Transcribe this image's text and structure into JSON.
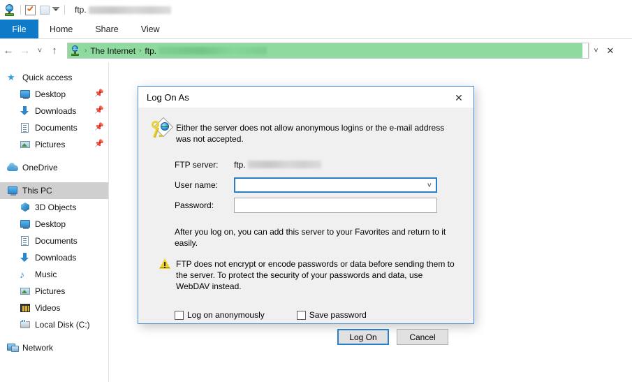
{
  "window": {
    "title_prefix": "ftp.",
    "title_redacted": true,
    "quick_access": [
      {
        "name": "ftp-site-icon",
        "label": "FTP site"
      },
      {
        "name": "properties-icon",
        "label": "Properties"
      },
      {
        "name": "new-folder-icon",
        "label": "New folder"
      },
      {
        "name": "customize-quick-access-caret",
        "label": "Customize Quick Access Toolbar"
      }
    ]
  },
  "ribbon": {
    "file_tab": "File",
    "tabs": [
      "Home",
      "Share",
      "View"
    ]
  },
  "navbar": {
    "back_icon": "←",
    "forward_icon": "→",
    "recent_icon": "˅",
    "up_icon": "↑",
    "breadcrumbs": [
      "The Internet",
      "ftp."
    ],
    "breadcrumb_separator": "›",
    "address_redacted": true,
    "progress_green": "#8fdb9f",
    "dropdown_icon": "˅",
    "stop_icon": "✕"
  },
  "sidebar": {
    "items": [
      {
        "label": "Quick access",
        "icon": "star-icon",
        "level": 0,
        "pinned": false,
        "selected": false
      },
      {
        "label": "Desktop",
        "icon": "desktop-icon",
        "level": 1,
        "pinned": true,
        "selected": false
      },
      {
        "label": "Downloads",
        "icon": "downloads-icon",
        "level": 1,
        "pinned": true,
        "selected": false
      },
      {
        "label": "Documents",
        "icon": "documents-icon",
        "level": 1,
        "pinned": true,
        "selected": false
      },
      {
        "label": "Pictures",
        "icon": "pictures-icon",
        "level": 1,
        "pinned": true,
        "selected": false
      },
      {
        "label": "OneDrive",
        "icon": "onedrive-cloud-icon",
        "level": 0,
        "pinned": false,
        "selected": false
      },
      {
        "label": "This PC",
        "icon": "this-pc-icon",
        "level": 0,
        "pinned": false,
        "selected": true
      },
      {
        "label": "3D Objects",
        "icon": "3d-objects-icon",
        "level": 1,
        "pinned": false,
        "selected": false
      },
      {
        "label": "Desktop",
        "icon": "desktop-icon",
        "level": 1,
        "pinned": false,
        "selected": false
      },
      {
        "label": "Documents",
        "icon": "documents-icon",
        "level": 1,
        "pinned": false,
        "selected": false
      },
      {
        "label": "Downloads",
        "icon": "downloads-icon",
        "level": 1,
        "pinned": false,
        "selected": false
      },
      {
        "label": "Music",
        "icon": "music-icon",
        "level": 1,
        "pinned": false,
        "selected": false
      },
      {
        "label": "Pictures",
        "icon": "pictures-icon",
        "level": 1,
        "pinned": false,
        "selected": false
      },
      {
        "label": "Videos",
        "icon": "videos-icon",
        "level": 1,
        "pinned": false,
        "selected": false
      },
      {
        "label": "Local Disk (C:)",
        "icon": "local-disk-icon",
        "level": 1,
        "pinned": false,
        "selected": false
      },
      {
        "label": "Network",
        "icon": "network-icon",
        "level": 0,
        "pinned": false,
        "selected": false
      }
    ],
    "pin_glyph": "📌"
  },
  "dialog": {
    "title": "Log On As",
    "close_icon": "✕",
    "message": "Either the server does not allow anonymous logins or the e-mail address was not accepted.",
    "fields": {
      "server_label": "FTP server:",
      "server_value_prefix": "ftp.",
      "server_value_redacted": true,
      "username_label": "User name:",
      "username_value": "",
      "username_dropdown_icon": "˅",
      "password_label": "Password:",
      "password_value": ""
    },
    "hint": "After you log on, you can add this server to your Favorites and return to it easily.",
    "warning": "FTP does not encrypt or encode passwords or data before sending them to the server.  To protect the security of your passwords and data, use WebDAV instead.",
    "checkboxes": [
      {
        "label": "Log on anonymously",
        "checked": false
      },
      {
        "label": "Save password",
        "checked": false
      }
    ],
    "buttons": [
      {
        "label": "Log On",
        "default": true
      },
      {
        "label": "Cancel",
        "default": false
      }
    ],
    "accent_color": "#2a7fc9"
  }
}
